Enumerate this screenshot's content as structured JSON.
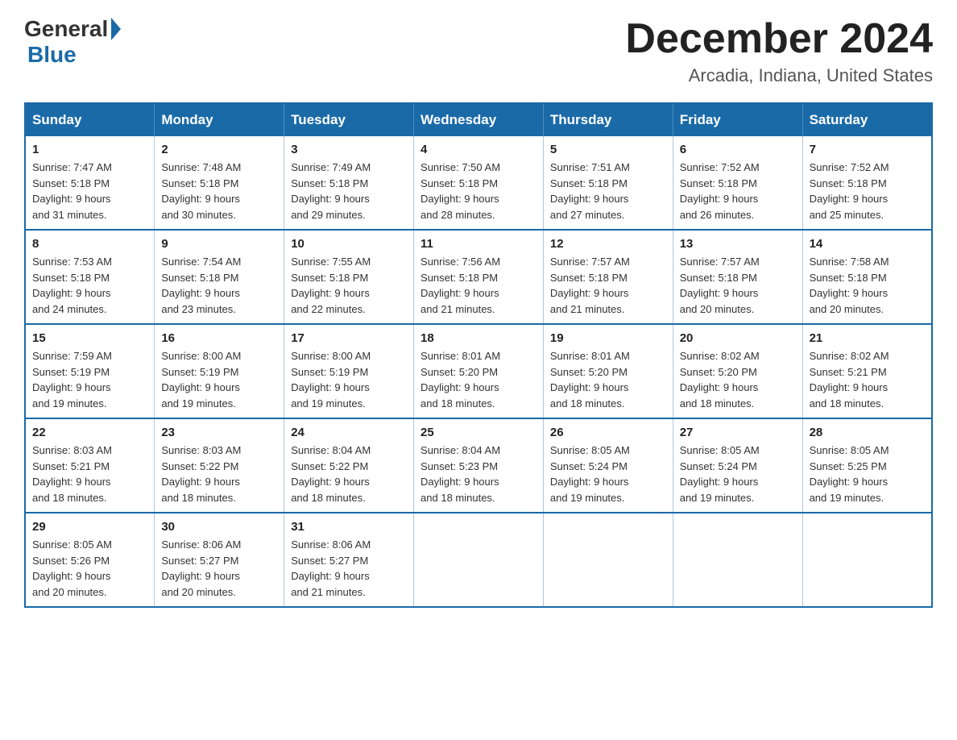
{
  "logo": {
    "general": "General",
    "blue": "Blue"
  },
  "title": {
    "month_year": "December 2024",
    "location": "Arcadia, Indiana, United States"
  },
  "weekdays": [
    "Sunday",
    "Monday",
    "Tuesday",
    "Wednesday",
    "Thursday",
    "Friday",
    "Saturday"
  ],
  "weeks": [
    [
      {
        "day": "1",
        "sunrise": "7:47 AM",
        "sunset": "5:18 PM",
        "daylight": "9 hours and 31 minutes."
      },
      {
        "day": "2",
        "sunrise": "7:48 AM",
        "sunset": "5:18 PM",
        "daylight": "9 hours and 30 minutes."
      },
      {
        "day": "3",
        "sunrise": "7:49 AM",
        "sunset": "5:18 PM",
        "daylight": "9 hours and 29 minutes."
      },
      {
        "day": "4",
        "sunrise": "7:50 AM",
        "sunset": "5:18 PM",
        "daylight": "9 hours and 28 minutes."
      },
      {
        "day": "5",
        "sunrise": "7:51 AM",
        "sunset": "5:18 PM",
        "daylight": "9 hours and 27 minutes."
      },
      {
        "day": "6",
        "sunrise": "7:52 AM",
        "sunset": "5:18 PM",
        "daylight": "9 hours and 26 minutes."
      },
      {
        "day": "7",
        "sunrise": "7:52 AM",
        "sunset": "5:18 PM",
        "daylight": "9 hours and 25 minutes."
      }
    ],
    [
      {
        "day": "8",
        "sunrise": "7:53 AM",
        "sunset": "5:18 PM",
        "daylight": "9 hours and 24 minutes."
      },
      {
        "day": "9",
        "sunrise": "7:54 AM",
        "sunset": "5:18 PM",
        "daylight": "9 hours and 23 minutes."
      },
      {
        "day": "10",
        "sunrise": "7:55 AM",
        "sunset": "5:18 PM",
        "daylight": "9 hours and 22 minutes."
      },
      {
        "day": "11",
        "sunrise": "7:56 AM",
        "sunset": "5:18 PM",
        "daylight": "9 hours and 21 minutes."
      },
      {
        "day": "12",
        "sunrise": "7:57 AM",
        "sunset": "5:18 PM",
        "daylight": "9 hours and 21 minutes."
      },
      {
        "day": "13",
        "sunrise": "7:57 AM",
        "sunset": "5:18 PM",
        "daylight": "9 hours and 20 minutes."
      },
      {
        "day": "14",
        "sunrise": "7:58 AM",
        "sunset": "5:18 PM",
        "daylight": "9 hours and 20 minutes."
      }
    ],
    [
      {
        "day": "15",
        "sunrise": "7:59 AM",
        "sunset": "5:19 PM",
        "daylight": "9 hours and 19 minutes."
      },
      {
        "day": "16",
        "sunrise": "8:00 AM",
        "sunset": "5:19 PM",
        "daylight": "9 hours and 19 minutes."
      },
      {
        "day": "17",
        "sunrise": "8:00 AM",
        "sunset": "5:19 PM",
        "daylight": "9 hours and 19 minutes."
      },
      {
        "day": "18",
        "sunrise": "8:01 AM",
        "sunset": "5:20 PM",
        "daylight": "9 hours and 18 minutes."
      },
      {
        "day": "19",
        "sunrise": "8:01 AM",
        "sunset": "5:20 PM",
        "daylight": "9 hours and 18 minutes."
      },
      {
        "day": "20",
        "sunrise": "8:02 AM",
        "sunset": "5:20 PM",
        "daylight": "9 hours and 18 minutes."
      },
      {
        "day": "21",
        "sunrise": "8:02 AM",
        "sunset": "5:21 PM",
        "daylight": "9 hours and 18 minutes."
      }
    ],
    [
      {
        "day": "22",
        "sunrise": "8:03 AM",
        "sunset": "5:21 PM",
        "daylight": "9 hours and 18 minutes."
      },
      {
        "day": "23",
        "sunrise": "8:03 AM",
        "sunset": "5:22 PM",
        "daylight": "9 hours and 18 minutes."
      },
      {
        "day": "24",
        "sunrise": "8:04 AM",
        "sunset": "5:22 PM",
        "daylight": "9 hours and 18 minutes."
      },
      {
        "day": "25",
        "sunrise": "8:04 AM",
        "sunset": "5:23 PM",
        "daylight": "9 hours and 18 minutes."
      },
      {
        "day": "26",
        "sunrise": "8:05 AM",
        "sunset": "5:24 PM",
        "daylight": "9 hours and 19 minutes."
      },
      {
        "day": "27",
        "sunrise": "8:05 AM",
        "sunset": "5:24 PM",
        "daylight": "9 hours and 19 minutes."
      },
      {
        "day": "28",
        "sunrise": "8:05 AM",
        "sunset": "5:25 PM",
        "daylight": "9 hours and 19 minutes."
      }
    ],
    [
      {
        "day": "29",
        "sunrise": "8:05 AM",
        "sunset": "5:26 PM",
        "daylight": "9 hours and 20 minutes."
      },
      {
        "day": "30",
        "sunrise": "8:06 AM",
        "sunset": "5:27 PM",
        "daylight": "9 hours and 20 minutes."
      },
      {
        "day": "31",
        "sunrise": "8:06 AM",
        "sunset": "5:27 PM",
        "daylight": "9 hours and 21 minutes."
      },
      null,
      null,
      null,
      null
    ]
  ],
  "labels": {
    "sunrise": "Sunrise:",
    "sunset": "Sunset:",
    "daylight": "Daylight:"
  }
}
